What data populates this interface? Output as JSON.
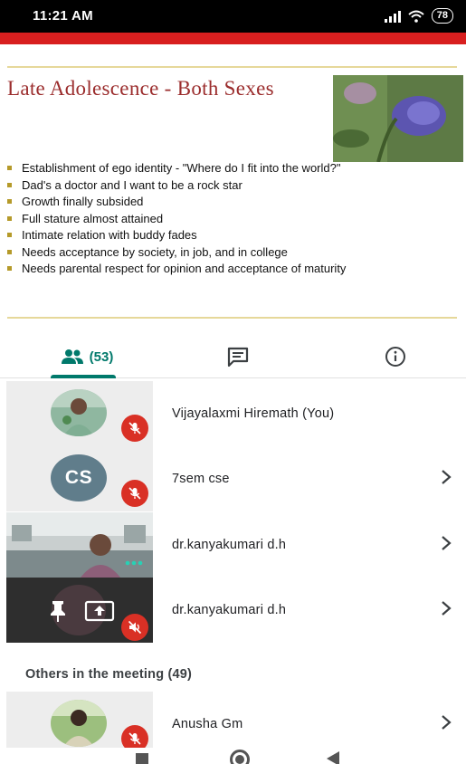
{
  "status_bar": {
    "time": "11:21 AM",
    "battery": "78",
    "icons": [
      "signal-icon",
      "wifi-icon",
      "battery-icon"
    ]
  },
  "slide": {
    "title": "Late Adolescence - Both Sexes",
    "bullets": [
      "Establishment of ego identity - \"Where do I fit into the world?\"",
      "Dad's a doctor and I want to be a rock star",
      "Growth finally subsided",
      "Full stature almost attained",
      "Intimate relation with buddy fades",
      "Needs acceptance by society, in job, and in college",
      "Needs parental respect for opinion and acceptance of maturity"
    ]
  },
  "tabs": {
    "people_count": "(53)",
    "icons": [
      "people-icon",
      "chat-icon",
      "info-icon"
    ]
  },
  "participants": [
    {
      "name": "Vijayalaxmi Hiremath (You)",
      "muted": true
    },
    {
      "name": "7sem cse",
      "initials": "CS",
      "muted": true
    },
    {
      "name": "dr.kanyakumari d.h",
      "muted": false
    },
    {
      "name": "dr.kanyakumari d.h",
      "muted": true
    }
  ],
  "others": {
    "heading": "Others in the meeting (49)",
    "participants": [
      {
        "name": "Anusha Gm",
        "muted": true
      }
    ]
  },
  "colors": {
    "accent": "#00796b",
    "mute_red": "#d93025",
    "slide_title": "#9b2d2d",
    "slide_bar": "#d81f1f",
    "cs_avatar": "#607d8b"
  }
}
